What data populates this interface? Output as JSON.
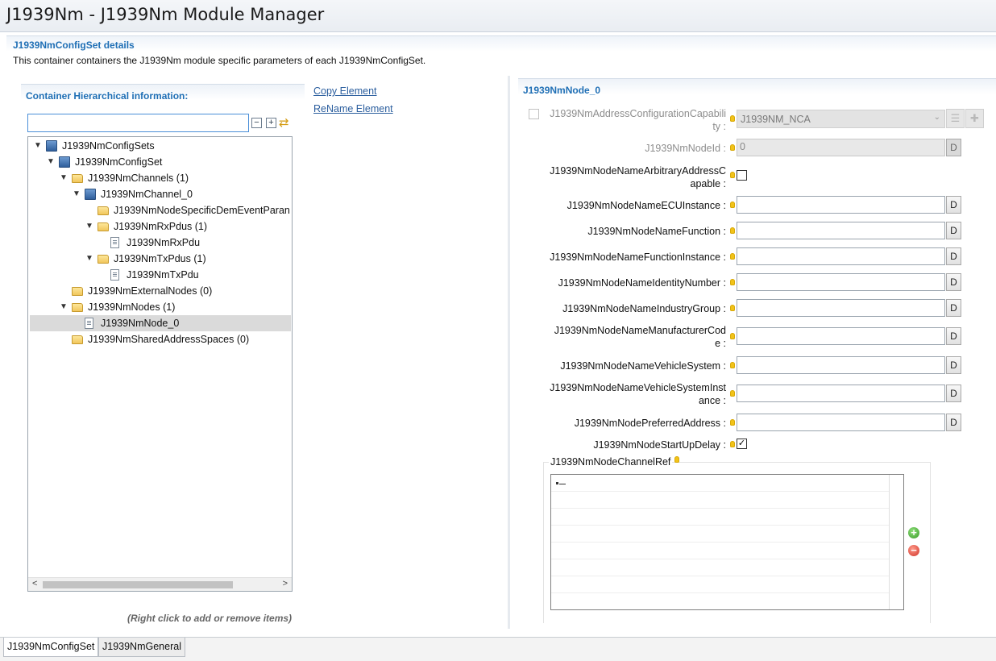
{
  "window": {
    "title": "J1939Nm - J1939Nm Module Manager"
  },
  "section": {
    "title": "J1939NmConfigSet details",
    "description": "This container containers the J1939Nm module specific parameters of each J1939NmConfigSet."
  },
  "hierarchy": {
    "heading": "Container Hierarchical information:",
    "filter_value": "",
    "tree": [
      {
        "label": "J1939NmConfigSets",
        "icon": "config-icon"
      },
      {
        "label": "J1939NmConfigSet",
        "icon": "config-icon"
      },
      {
        "label": "J1939NmChannels (1)",
        "icon": "folder-icon"
      },
      {
        "label": "J1939NmChannel_0",
        "icon": "config-icon"
      },
      {
        "label": "J1939NmNodeSpecificDemEventParan",
        "icon": "folder-icon"
      },
      {
        "label": "J1939NmRxPdus (1)",
        "icon": "folder-icon"
      },
      {
        "label": "J1939NmRxPdu",
        "icon": "document-icon"
      },
      {
        "label": "J1939NmTxPdus (1)",
        "icon": "folder-icon"
      },
      {
        "label": "J1939NmTxPdu",
        "icon": "document-icon"
      },
      {
        "label": "J1939NmExternalNodes (0)",
        "icon": "folder-icon"
      },
      {
        "label": "J1939NmNodes (1)",
        "icon": "folder-icon"
      },
      {
        "label": "J1939NmNode_0",
        "icon": "document-icon",
        "selected": true
      },
      {
        "label": "J1939NmSharedAddressSpaces (0)",
        "icon": "folder-icon"
      }
    ],
    "hint": "(Right click to add or remove items)"
  },
  "actions": {
    "copy": "Copy Element",
    "rename": "ReName Element"
  },
  "details": {
    "title": "J1939NmNode_0",
    "address_config": {
      "label_line1": "J1939NmAddressConfigurationCapabili",
      "label_line2": "ty :",
      "value": "J1939NM_NCA"
    },
    "node_id": {
      "label": "J1939NmNodeId :",
      "value": "0"
    },
    "arb_address": {
      "label_line1": "J1939NmNodeNameArbitraryAddressC",
      "label_line2": "apable :"
    },
    "ecu_instance": {
      "label": "J1939NmNodeNameECUInstance :"
    },
    "function": {
      "label": "J1939NmNodeNameFunction :"
    },
    "function_instance": {
      "label": "J1939NmNodeNameFunctionInstance :"
    },
    "identity_number": {
      "label": "J1939NmNodeNameIdentityNumber :"
    },
    "industry_group": {
      "label": "J1939NmNodeNameIndustryGroup :"
    },
    "manufacturer_code": {
      "label_line1": "J1939NmNodeNameManufacturerCod",
      "label_line2": "e :"
    },
    "vehicle_system": {
      "label": "J1939NmNodeNameVehicleSystem :"
    },
    "vehicle_system_instance": {
      "label_line1": "J1939NmNodeNameVehicleSystemInst",
      "label_line2": "ance :"
    },
    "preferred_address": {
      "label": "J1939NmNodePreferredAddress :"
    },
    "startup_delay": {
      "label": "J1939NmNodeStartUpDelay :",
      "checked": true
    },
    "default_button": "D",
    "channel_ref": {
      "label": "J1939NmNodeChannelRef"
    }
  },
  "tabs": [
    "J1939NmConfigSet",
    "J1939NmGeneral"
  ]
}
